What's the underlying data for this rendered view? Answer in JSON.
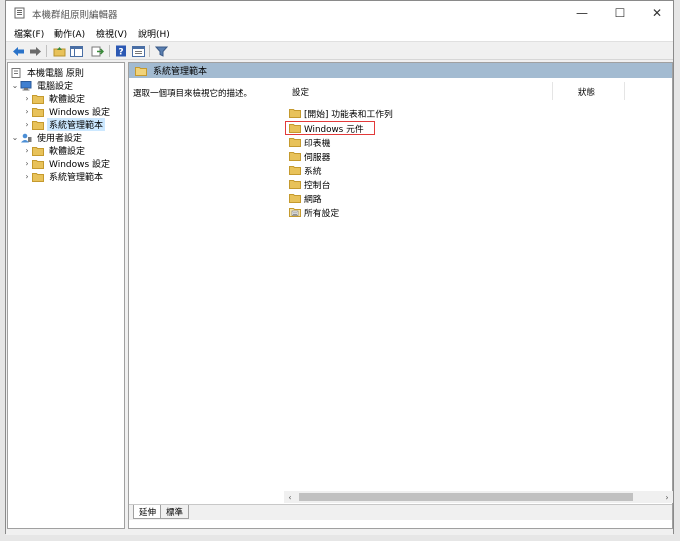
{
  "window": {
    "title": "本機群組原則編輯器",
    "minimize_glyph": "—",
    "maximize_glyph": "☐",
    "close_glyph": "✕"
  },
  "menu": [
    "檔案(F)",
    "動作(A)",
    "檢視(V)",
    "說明(H)"
  ],
  "toolbar": {
    "icons": [
      "back-arrow-icon",
      "forward-arrow-icon",
      "up-folder-icon",
      "show-tree-icon",
      "export-icon",
      "help-icon",
      "properties-icon",
      "filter-icon"
    ]
  },
  "tree": {
    "root": "本機電腦 原則",
    "items": [
      {
        "label": "電腦設定",
        "level": 1,
        "expanded": true
      },
      {
        "label": "軟體設定",
        "level": 2
      },
      {
        "label": "Windows 設定",
        "level": 2
      },
      {
        "label": "系統管理範本",
        "level": 2,
        "selected": true
      },
      {
        "label": "使用者設定",
        "level": 1,
        "expanded": true
      },
      {
        "label": "軟體設定",
        "level": 2
      },
      {
        "label": "Windows 設定",
        "level": 2
      },
      {
        "label": "系統管理範本",
        "level": 2
      }
    ]
  },
  "pane": {
    "header": "系統管理範本",
    "description": "選取一個項目來檢視它的描述。",
    "columns": [
      "設定",
      "狀態"
    ],
    "rows": [
      "[開始] 功能表和工作列",
      "Windows 元件",
      "印表機",
      "伺服器",
      "系統",
      "控制台",
      "網路",
      "所有設定"
    ]
  },
  "tabs": [
    "延伸",
    "標準"
  ],
  "colors": {
    "header_bg": "#a3bbd1",
    "selection": "#cce8ff",
    "highlight": "#e23a3a",
    "folder": "#e8c25a"
  }
}
